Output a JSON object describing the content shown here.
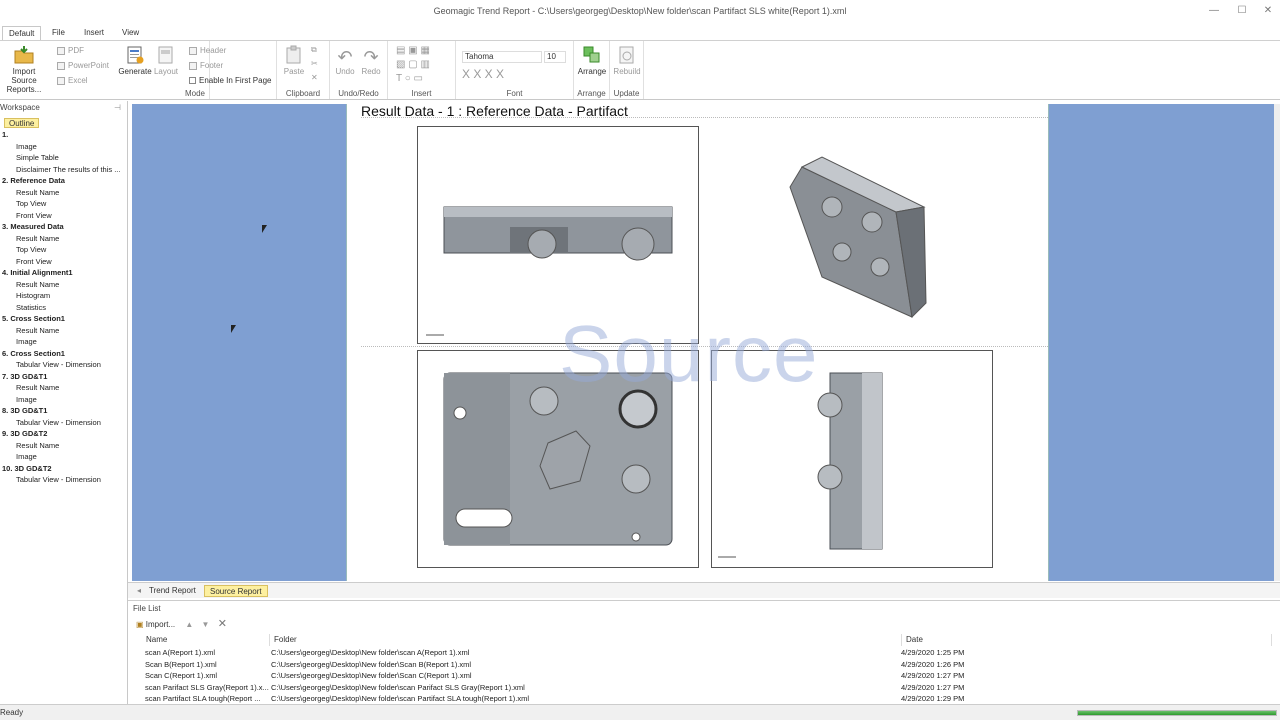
{
  "window": {
    "title": "Geomagic Trend Report - C:\\Users\\georgeg\\Desktop\\New folder\\scan Partifact SLS white(Report 1).xml"
  },
  "tabs": [
    "Default",
    "File",
    "Insert",
    "View"
  ],
  "ribbon": {
    "import_label_1": "Import Source",
    "import_label_2": "Reports...",
    "pdf": "PDF",
    "powerpoint": "PowerPoint",
    "excel": "Excel",
    "generate": "Generate",
    "layout": "Layout",
    "header": "Header",
    "footer": "Footer",
    "enable_first_page": "Enable In First Page",
    "mode": "Mode",
    "paste": "Paste",
    "clipboard": "Clipboard",
    "undo": "Undo",
    "redo": "Redo",
    "undo_redo": "Undo/Redo",
    "insert": "Insert",
    "font_name": "Tahoma",
    "font_size": "10",
    "font": "Font",
    "arrange_btn": "Arrange",
    "arrange": "Arrange",
    "rebuild": "Rebuild",
    "update": "Update"
  },
  "workspace": {
    "title": "Workspace",
    "outline_tab": "Outline",
    "tree": [
      {
        "type": "sec",
        "label": "1."
      },
      {
        "type": "item",
        "label": "Image"
      },
      {
        "type": "item",
        "label": "Simple Table"
      },
      {
        "type": "item",
        "label": "Disclaimer The results of this ..."
      },
      {
        "type": "sec",
        "label": "2. Reference Data"
      },
      {
        "type": "item",
        "label": "Result Name"
      },
      {
        "type": "item",
        "label": "Top View"
      },
      {
        "type": "item",
        "label": "Front View"
      },
      {
        "type": "sec",
        "label": "3. Measured Data"
      },
      {
        "type": "item",
        "label": "Result Name"
      },
      {
        "type": "item",
        "label": "Top View"
      },
      {
        "type": "item",
        "label": "Front View"
      },
      {
        "type": "sec",
        "label": "4. Initial Alignment1"
      },
      {
        "type": "item",
        "label": "Result Name"
      },
      {
        "type": "item",
        "label": "Histogram"
      },
      {
        "type": "item",
        "label": "Statistics"
      },
      {
        "type": "sec",
        "label": "5. Cross Section1"
      },
      {
        "type": "item",
        "label": "Result Name"
      },
      {
        "type": "item",
        "label": "Image"
      },
      {
        "type": "sec",
        "label": "6. Cross Section1"
      },
      {
        "type": "item",
        "label": "Tabular View - Dimension"
      },
      {
        "type": "sec",
        "label": "7. 3D GD&T1"
      },
      {
        "type": "item",
        "label": "Result Name"
      },
      {
        "type": "item",
        "label": "Image"
      },
      {
        "type": "sec",
        "label": "8. 3D GD&T1"
      },
      {
        "type": "item",
        "label": "Tabular View - Dimension"
      },
      {
        "type": "sec",
        "label": "9. 3D GD&T2"
      },
      {
        "type": "item",
        "label": "Result Name"
      },
      {
        "type": "item",
        "label": "Image"
      },
      {
        "type": "sec",
        "label": "10. 3D GD&T2"
      },
      {
        "type": "item",
        "label": "Tabular View - Dimension"
      }
    ]
  },
  "page": {
    "header": "Result Data - 1   :   Reference Data   -   Partifact",
    "watermark": "Source"
  },
  "sheet_tabs": [
    "Trend Report",
    "Source Report"
  ],
  "file_list": {
    "title": "File List",
    "import": "Import...",
    "columns": [
      "Name",
      "Folder",
      "Date"
    ],
    "rows": [
      {
        "name": "scan A(Report 1).xml",
        "folder": "C:\\Users\\georgeg\\Desktop\\New folder\\scan A(Report 1).xml",
        "date": "4/29/2020 1:25 PM"
      },
      {
        "name": "Scan B(Report 1).xml",
        "folder": "C:\\Users\\georgeg\\Desktop\\New folder\\Scan B(Report 1).xml",
        "date": "4/29/2020 1:26 PM"
      },
      {
        "name": "Scan C(Report 1).xml",
        "folder": "C:\\Users\\georgeg\\Desktop\\New folder\\Scan C(Report 1).xml",
        "date": "4/29/2020 1:27 PM"
      },
      {
        "name": "scan Parifact SLS Gray(Report 1).x...",
        "folder": "C:\\Users\\georgeg\\Desktop\\New folder\\scan Parifact SLS Gray(Report 1).xml",
        "date": "4/29/2020 1:27 PM"
      },
      {
        "name": "scan Partifact SLA tough(Report ...",
        "folder": "C:\\Users\\georgeg\\Desktop\\New folder\\scan Partifact SLA tough(Report 1).xml",
        "date": "4/29/2020 1:29 PM"
      }
    ]
  },
  "status": {
    "text": "Ready",
    "progress_fraction": 1.0
  }
}
